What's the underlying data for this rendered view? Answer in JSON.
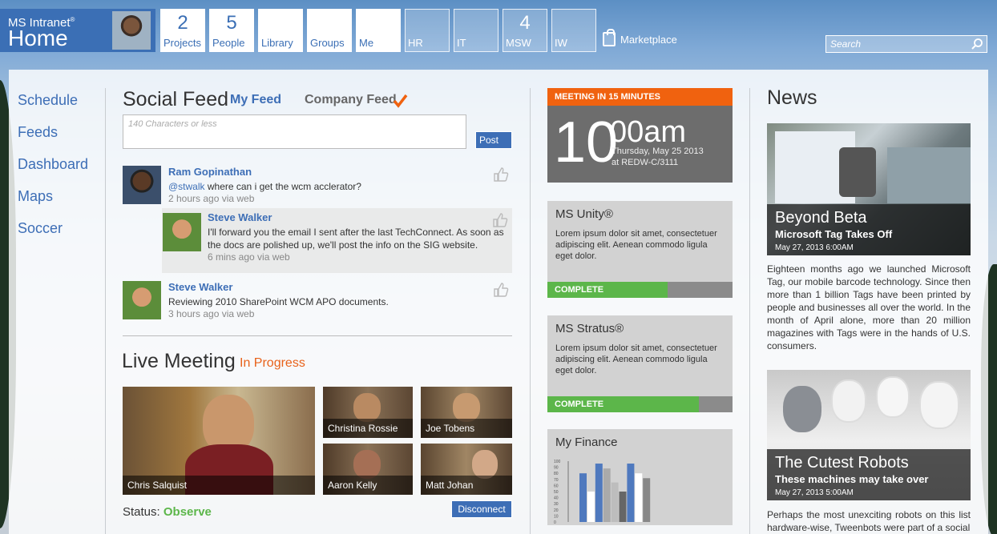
{
  "brand": {
    "title_small": "MS Intranet",
    "title_small_mark": "®",
    "title_big": "Home"
  },
  "tiles": [
    {
      "num": "2",
      "label": "Projects"
    },
    {
      "num": "5",
      "label": "People"
    },
    {
      "num": "",
      "label": "Library"
    },
    {
      "num": "",
      "label": "Groups"
    },
    {
      "num": "",
      "label": "Me"
    },
    {
      "num": "",
      "label": "HR"
    },
    {
      "num": "",
      "label": "IT"
    },
    {
      "num": "4",
      "label": "MSW"
    },
    {
      "num": "",
      "label": "IW"
    }
  ],
  "marketplace": {
    "label": "Marketplace"
  },
  "search": {
    "placeholder": "Search"
  },
  "nav": {
    "items": [
      "Schedule",
      "Feeds",
      "Dashboard",
      "Maps",
      "Soccer"
    ]
  },
  "social": {
    "title": "Social Feed",
    "tab_my": "My Feed",
    "tab_company": "Company Feed",
    "placeholder": "140 Characters or less",
    "post_button": "Post",
    "posts": [
      {
        "name": "Ram Gopinathan",
        "mention": "@stwalk",
        "text": " where can i get the wcm acclerator?",
        "time": "2 hours ago via web"
      },
      {
        "name": "Steve Walker",
        "text": "I'll forward you the email I sent after the last TechConnect. As soon as the docs are polished up, we'll post the info on the SIG website.",
        "time": "6 mins ago via web"
      },
      {
        "name": "Steve Walker",
        "text": "Reviewing 2010 SharePoint WCM APO documents.",
        "time": "3 hours ago via web"
      }
    ]
  },
  "live": {
    "title": "Live Meeting",
    "state": "In Progress",
    "participants": [
      "Chris Salquist",
      "Christina Rossie",
      "Joe Tobens",
      "Aaron Kelly",
      "Matt Johan"
    ],
    "status_label": "Status: ",
    "status_value": "Observe",
    "disconnect": "Disconnect"
  },
  "meeting": {
    "banner": "MEETING IN 15 MINUTES",
    "hour": "10",
    "rest": "00am",
    "date": "Thursday, May 25 2013",
    "location": "at REDW-C/3111"
  },
  "cards": [
    {
      "title": "MS Unity®",
      "body": "Lorem ipsum dolor sit amet, consectetuer adipiscing elit. Aenean commodo ligula eget dolor.",
      "status": "COMPLETE",
      "progress": 0.65
    },
    {
      "title": "MS Stratus®",
      "body": "Lorem ipsum dolor sit amet, consectetuer adipiscing elit. Aenean commodo ligula eget dolor.",
      "status": "COMPLETE",
      "progress": 0.82
    }
  ],
  "finance": {
    "title": "My Finance",
    "y_ticks": [
      "100",
      "90",
      "80",
      "70",
      "60",
      "50",
      "40",
      "30",
      "20",
      "10",
      "0"
    ],
    "bars": [
      {
        "v": 80,
        "c": "#4f79be"
      },
      {
        "v": 50,
        "c": "#ffffff"
      },
      {
        "v": 96,
        "c": "#4f79be"
      },
      {
        "v": 88,
        "c": "#aaaaaa"
      },
      {
        "v": 65,
        "c": "#bdbdbd"
      },
      {
        "v": 50,
        "c": "#666666"
      },
      {
        "v": 96,
        "c": "#4f79be"
      },
      {
        "v": 80,
        "c": "#ffffff"
      },
      {
        "v": 72,
        "c": "#888888"
      }
    ]
  },
  "news": {
    "title": "News",
    "items": [
      {
        "title": "Beyond Beta",
        "subtitle": "Microsoft Tag Takes Off",
        "date": "May 27, 2013 6:00AM",
        "body": "Eighteen months ago we launched Microsoft Tag, our mobile barcode technology. Since then more than 1 billion Tags have been printed by people and businesses all over the world. In the month of April alone, more than 20 million magazines with Tags were in the hands of U.S. consumers."
      },
      {
        "title": "The Cutest Robots",
        "subtitle": "These machines may take over",
        "date": "May 27, 2013 5:00AM",
        "body": "Perhaps the most unexciting robots on this list hardware-wise, Tweenbots were part of a social"
      }
    ]
  }
}
